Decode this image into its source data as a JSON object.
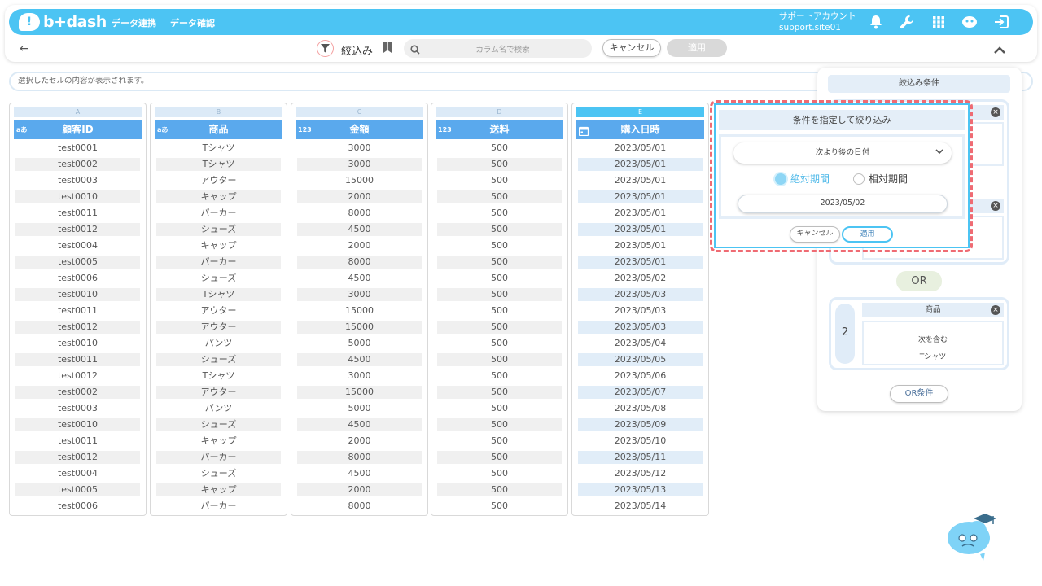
{
  "header": {
    "logo_glyph": "!",
    "logo_text": "b+dash",
    "nav": [
      "データ連携",
      "データ確認"
    ],
    "account_name": "サポートアカウント",
    "account_id": "support.site01"
  },
  "toolbar": {
    "filter_label": "絞込み",
    "search_placeholder": "カラム名で検索",
    "cancel_label": "キャンセル",
    "apply_label": "適用"
  },
  "cell_display_placeholder": "選択したセルの内容が表示されます。",
  "columns": [
    {
      "letter": "A",
      "header": "顧客ID",
      "type": "aあ",
      "active": false,
      "values": [
        "test0001",
        "test0002",
        "test0003",
        "test0010",
        "test0011",
        "test0012",
        "test0004",
        "test0005",
        "test0006",
        "test0010",
        "test0011",
        "test0012",
        "test0010",
        "test0011",
        "test0012",
        "test0002",
        "test0003",
        "test0010",
        "test0011",
        "test0012",
        "test0004",
        "test0005",
        "test0006"
      ]
    },
    {
      "letter": "B",
      "header": "商品",
      "type": "aあ",
      "active": false,
      "values": [
        "Tシャツ",
        "Tシャツ",
        "アウター",
        "キャップ",
        "パーカー",
        "シューズ",
        "キャップ",
        "パーカー",
        "シューズ",
        "Tシャツ",
        "アウター",
        "アウター",
        "パンツ",
        "シューズ",
        "Tシャツ",
        "アウター",
        "パンツ",
        "シューズ",
        "キャップ",
        "パーカー",
        "シューズ",
        "キャップ",
        "パーカー"
      ]
    },
    {
      "letter": "C",
      "header": "金額",
      "type": "123",
      "active": false,
      "values": [
        "3000",
        "3000",
        "15000",
        "2000",
        "8000",
        "4500",
        "2000",
        "8000",
        "4500",
        "3000",
        "15000",
        "15000",
        "5000",
        "4500",
        "3000",
        "15000",
        "5000",
        "4500",
        "2000",
        "8000",
        "4500",
        "2000",
        "8000"
      ]
    },
    {
      "letter": "D",
      "header": "送料",
      "type": "123",
      "active": false,
      "values": [
        "500",
        "500",
        "500",
        "500",
        "500",
        "500",
        "500",
        "500",
        "500",
        "500",
        "500",
        "500",
        "500",
        "500",
        "500",
        "500",
        "500",
        "500",
        "500",
        "500",
        "500",
        "500",
        "500"
      ]
    },
    {
      "letter": "E",
      "header": "購入日時",
      "type": "calendar-icon",
      "active": true,
      "values": [
        "2023/05/01",
        "2023/05/01",
        "2023/05/01",
        "2023/05/01",
        "2023/05/01",
        "2023/05/01",
        "2023/05/01",
        "2023/05/01",
        "2023/05/02",
        "2023/05/03",
        "2023/05/03",
        "2023/05/03",
        "2023/05/04",
        "2023/05/05",
        "2023/05/06",
        "2023/05/07",
        "2023/05/08",
        "2023/05/09",
        "2023/05/10",
        "2023/05/11",
        "2023/05/12",
        "2023/05/13",
        "2023/05/14"
      ]
    }
  ],
  "filter_panel": {
    "title": "絞込み条件",
    "or_label": "OR",
    "or_condition_button": "OR条件",
    "group2": {
      "number": "2",
      "column": "商品",
      "condition": "次を含む",
      "value": "Tシャツ"
    }
  },
  "popup": {
    "title": "条件を指定して絞り込み",
    "condition": "次より後の日付",
    "radio_absolute": "絶対期間",
    "radio_relative": "相対期間",
    "selected_radio": "absolute",
    "date_value": "2023/05/02",
    "cancel_label": "キャンセル",
    "apply_label": "適用"
  },
  "colors": {
    "primary": "#4cc4f3",
    "header_blue": "#5aa9ed",
    "highlight": "#ef6b73"
  }
}
